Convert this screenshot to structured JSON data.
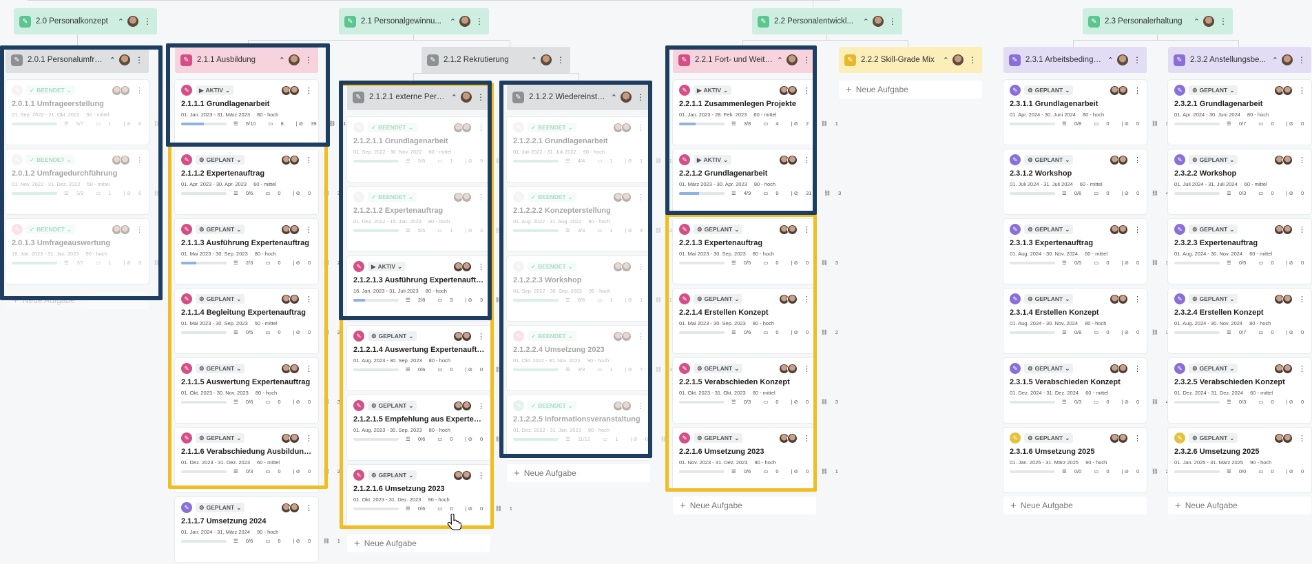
{
  "colors": {
    "green_header": "#cdeee1",
    "gray_header": "#dedfe0",
    "pink_header": "#f7d3dd",
    "yellow_header": "#fbeeb8",
    "purple_header": "#e2ddf5",
    "highlight_blue": "#1d3d61",
    "highlight_yellow": "#f0be22"
  },
  "icons": {
    "header_edit": "pencil-icon",
    "collapse": "chevron-up-icon",
    "avatar": "avatar-icon",
    "more": "kebab-menu-icon",
    "add": "plus-icon",
    "cursor": "hand-pointer-icon"
  },
  "add_label": "Neue Aufgabe",
  "top_headers": [
    {
      "title": "2.0 Personalkonzept",
      "color": "green"
    },
    {
      "title": "2.1 Personalgewinnu...",
      "color": "green"
    },
    {
      "title": "2.2 Personalentwickl...",
      "color": "green"
    },
    {
      "title": "2.3 Personalerhaltung",
      "color": "green"
    }
  ],
  "mid_headers": [
    {
      "title": "2.1.2 Rekrutierung",
      "color": "gray"
    }
  ],
  "columns": [
    {
      "title": "2.0.1 Personalumfrage",
      "color": "gray",
      "show_add": true,
      "add_faded": true,
      "cards": [
        {
          "status": "BEENDET",
          "title": "2.0.1.1 Umfrageerstellung",
          "dates": "01. Sep. 2022 - 21. Okt. 2022",
          "priority": "50 - mittel",
          "progress": 1.0,
          "subtasks": "5/7",
          "comments": "1",
          "attachments": "6",
          "links": "1",
          "pen": "#e6e6e6",
          "faded": true
        },
        {
          "status": "BEENDET",
          "title": "2.0.1.2 Umfragedurchführung",
          "dates": "01. Nov. 2022 - 31. Dez. 2022",
          "priority": "50 - mittel",
          "progress": 1.0,
          "subtasks": "3/3",
          "comments": "1",
          "attachments": "6",
          "links": "2",
          "pen": "#e6e6e6",
          "faded": true
        },
        {
          "status": "BEENDET",
          "title": "2.0.1.3 Umfrageauswertung",
          "dates": "16. Jan. 2023 - 31. Jan. 2023",
          "priority": "90 - hoch",
          "progress": 1.0,
          "subtasks": "7/7",
          "comments": "1",
          "attachments": "3",
          "links": "2",
          "pen": "#f5b8c8",
          "faded": true
        }
      ]
    },
    {
      "title": "2.1.1 Ausbildung",
      "color": "pink",
      "show_add": false,
      "cards": [
        {
          "status": "AKTIV",
          "title": "2.1.1.1 Grundlagenarbeit",
          "dates": "01. Jan. 2023 - 31. März 2023",
          "priority": "80 - hoch",
          "progress": 0.5,
          "subtasks": "5/10",
          "comments": "8",
          "attachments": "39",
          "links": "1",
          "pen": "#d44f87"
        },
        {
          "status": "GEPLANT",
          "title": "2.1.1.2 Expertenauftrag",
          "dates": "01. Apr. 2023 - 30. Apr. 2023",
          "priority": "60 - mittel",
          "progress": 0,
          "subtasks": "0/6",
          "comments": "0",
          "attachments": "0",
          "links": "3",
          "pen": "#d44f87"
        },
        {
          "status": "GEPLANT",
          "title": "2.1.1.3 Ausführung Expertenauftrag",
          "dates": "01. Mai 2023 - 30. Sep. 2023",
          "priority": "80 - hoch",
          "progress": 0.33,
          "subtasks": "2/3",
          "comments": "0",
          "attachments": "0",
          "links": "2",
          "pen": "#d44f87"
        },
        {
          "status": "GEPLANT",
          "title": "2.1.1.4 Begleitung Expertenauftrag",
          "dates": "01. Mai 2023 - 30. Sep. 2023",
          "priority": "50 - mittel",
          "progress": 0,
          "subtasks": "0/5",
          "comments": "0",
          "attachments": "0",
          "links": "2",
          "pen": "#d44f87"
        },
        {
          "status": "GEPLANT",
          "title": "2.1.1.5 Auswertung Expertenauftrag",
          "dates": "01. Okt. 2023 - 30. Nov. 2023",
          "priority": "80 - hoch",
          "progress": 0,
          "subtasks": "0/6",
          "comments": "0",
          "attachments": "0",
          "links": "3",
          "pen": "#d44f87"
        },
        {
          "status": "GEPLANT",
          "title": "2.1.1.6 Verabschiedung Ausbildungsk...",
          "dates": "01. Dez. 2023 - 31. Dez. 2023",
          "priority": "60 - mittel",
          "progress": 0,
          "subtasks": "0/3",
          "comments": "0",
          "attachments": "0",
          "links": "2",
          "pen": "#d44f87"
        },
        {
          "status": "GEPLANT",
          "title": "2.1.1.7 Umsetzung 2024",
          "dates": "01. Jan. 2024 - 31. März 2024",
          "priority": "90 - hoch",
          "progress": 0,
          "subtasks": "0/6",
          "comments": "0",
          "attachments": "0",
          "links": "1",
          "pen": "#8a6fd8"
        }
      ]
    },
    {
      "title": "2.1.2.1 externe Perso...",
      "color": "gray",
      "show_add": true,
      "cards": [
        {
          "status": "BEENDET",
          "title": "2.1.2.1.1 Grundlagenarbeit",
          "dates": "01. Sep. 2022 - 30. Nov. 2022",
          "priority": "60 - mittel",
          "progress": 1.0,
          "subtasks": "5/5",
          "comments": "1",
          "attachments": "9",
          "links": "1",
          "pen": "#e6e6e6",
          "faded": true
        },
        {
          "status": "BEENDET",
          "title": "2.1.2.1.2 Expertenauftrag",
          "dates": "01. Dez. 2022 - 15. Jan. 2023",
          "priority": "80 - hoch",
          "progress": 1.0,
          "subtasks": "5/5",
          "comments": "1",
          "attachments": "3",
          "links": "2",
          "pen": "#e6e6e6",
          "faded": true
        },
        {
          "status": "AKTIV",
          "title": "2.1.2.1.3 Ausführung Expertenauftrag",
          "dates": "16. Jan. 2023 - 31. Juli 2023",
          "priority": "80 - hoch",
          "progress": 0.25,
          "subtasks": "2/8",
          "comments": "3",
          "attachments": "3",
          "links": "2",
          "pen": "#d44f87"
        },
        {
          "status": "GEPLANT",
          "title": "2.1.2.1.4 Auswertung Expertenauftrag",
          "dates": "01. Aug. 2023 - 30. Sep. 2023",
          "priority": "80 - hoch",
          "progress": 0,
          "subtasks": "0/6",
          "comments": "0",
          "attachments": "0",
          "links": "3",
          "pen": "#d44f87"
        },
        {
          "status": "GEPLANT",
          "title": "2.1.2.1.5 Empfehlung aus Expertenber...",
          "dates": "01. Aug. 2023 - 30. Sep. 2023",
          "priority": "80 - hoch",
          "progress": 0,
          "subtasks": "0/6",
          "comments": "0",
          "attachments": "0",
          "links": "2",
          "pen": "#d44f87"
        },
        {
          "status": "GEPLANT",
          "title": "2.1.2.1.6 Umsetzung 2023",
          "dates": "01. Okt. 2023 - 31. Dez. 2023",
          "priority": "90 - hoch",
          "progress": 0,
          "subtasks": "0/6",
          "comments": "0",
          "attachments": "0",
          "links": "1",
          "pen": "#d44f87"
        }
      ]
    },
    {
      "title": "2.1.2.2 Wiedereinstei...",
      "color": "gray",
      "show_add": true,
      "cards": [
        {
          "status": "BEENDET",
          "title": "2.1.2.2.1 Grundlagenarbeit",
          "dates": "01. Juli 2022 - 31. Juli 2022",
          "priority": "90 - hoch",
          "progress": 1.0,
          "subtasks": "4/4",
          "comments": "1",
          "attachments": "1",
          "links": "1",
          "pen": "#e6e6e6",
          "faded": true
        },
        {
          "status": "BEENDET",
          "title": "2.1.2.2.2 Konzepterstellung",
          "dates": "01. Aug. 2022 - 31. Aug. 2022",
          "priority": "90 - hoch",
          "progress": 1.0,
          "subtasks": "3/3",
          "comments": "1",
          "attachments": "4",
          "links": "2",
          "pen": "#e6e6e6",
          "faded": true
        },
        {
          "status": "BEENDET",
          "title": "2.1.2.2.3 Workshop",
          "dates": "01. Sep. 2022 - 30. Sep. 2022",
          "priority": "90 - hoch",
          "progress": 1.0,
          "subtasks": "6/6",
          "comments": "1",
          "attachments": "1",
          "links": "1",
          "pen": "#e6e6e6",
          "faded": true
        },
        {
          "status": "BEENDET",
          "title": "2.1.2.2.4 Umsetzung 2023",
          "dates": "01. Okt. 2022 - 30. Nov. 2022",
          "priority": "90 - hoch",
          "progress": 1.0,
          "subtasks": "3/3",
          "comments": "1",
          "attachments": "7",
          "links": "3",
          "pen": "#f5b8c8",
          "faded": true
        },
        {
          "status": "BEENDET",
          "title": "2.1.2.2.5 Informationsveranstaltung",
          "dates": "01. Dez. 2022 - 31. Jan. 2023",
          "priority": "90 - hoch",
          "progress": 1.0,
          "subtasks": "11/12",
          "comments": "1",
          "attachments": "0",
          "links": "1",
          "pen": "#b8e6cc",
          "faded": true
        }
      ]
    },
    {
      "title": "2.2.1 Fort- und Weite...",
      "color": "pink",
      "show_add": true,
      "cards": [
        {
          "status": "AKTIV",
          "title": "2.2.1.1 Zusammenlegen Projekte",
          "dates": "01. Jan. 2023 - 28. Feb. 2023",
          "priority": "60 - mittel",
          "progress": 0.37,
          "subtasks": "3/8",
          "comments": "4",
          "attachments": "2",
          "links": "1",
          "pen": "#d44f87"
        },
        {
          "status": "AKTIV",
          "title": "2.2.1.2 Grundlagenarbeit",
          "dates": "01. März 2023 - 30. Apr. 2023",
          "priority": "80 - hoch",
          "progress": 0.44,
          "subtasks": "4/9",
          "comments": "9",
          "attachments": "31",
          "links": "3",
          "pen": "#d44f87"
        },
        {
          "status": "GEPLANT",
          "title": "2.2.1.3 Expertenauftrag",
          "dates": "01. Mai 2023 - 30. Sep. 2023",
          "priority": "80 - hoch",
          "progress": 0,
          "subtasks": "0/5",
          "comments": "0",
          "attachments": "0",
          "links": "3",
          "pen": "#d44f87"
        },
        {
          "status": "GEPLANT",
          "title": "2.2.1.4 Erstellen Konzept",
          "dates": "01. Mai 2023 - 30. Sep. 2023",
          "priority": "80 - hoch",
          "progress": 0,
          "subtasks": "0/6",
          "comments": "0",
          "attachments": "0",
          "links": "2",
          "pen": "#d44f87"
        },
        {
          "status": "GEPLANT",
          "title": "2.2.1.5 Verabschieden Konzept",
          "dates": "01. Okt. 2023 - 31. Okt. 2023",
          "priority": "60 - mittel",
          "progress": 0,
          "subtasks": "0/3",
          "comments": "0",
          "attachments": "0",
          "links": "3",
          "pen": "#d44f87"
        },
        {
          "status": "GEPLANT",
          "title": "2.2.1.6 Umsetzung 2023",
          "dates": "01. Nov. 2023 - 31. Dez. 2023",
          "priority": "90 - hoch",
          "progress": 0,
          "subtasks": "0/6",
          "comments": "0",
          "attachments": "0",
          "links": "1",
          "pen": "#d44f87"
        }
      ]
    },
    {
      "title": "2.2.2 Skill-Grade Mix",
      "color": "yellow",
      "show_add": true,
      "cards": []
    },
    {
      "title": "2.3.1 Arbeitsbedingu...",
      "color": "purple",
      "show_add": true,
      "cards": [
        {
          "status": "GEPLANT",
          "title": "2.3.1.1 Grundlagenarbeit",
          "dates": "01. Apr. 2024 - 30. Juni 2024",
          "priority": "80 - hoch",
          "progress": 0,
          "subtasks": "0/8",
          "comments": "0",
          "attachments": "0",
          "links": "3",
          "pen": "#8a6fd8"
        },
        {
          "status": "GEPLANT",
          "title": "2.3.1.2 Workshop",
          "dates": "01. Juli 2024 - 31. Juli 2024",
          "priority": "60 - mittel",
          "progress": 0,
          "subtasks": "0/6",
          "comments": "0",
          "attachments": "0",
          "links": "4",
          "pen": "#8a6fd8"
        },
        {
          "status": "GEPLANT",
          "title": "2.3.1.3 Expertenauftrag",
          "dates": "01. Aug. 2024 - 30. Nov. 2024",
          "priority": "60 - mittel",
          "progress": 0,
          "subtasks": "0/5",
          "comments": "0",
          "attachments": "0",
          "links": "3",
          "pen": "#8a6fd8"
        },
        {
          "status": "GEPLANT",
          "title": "2.3.1.4 Erstellen Konzept",
          "dates": "01. Aug. 2024 - 30. Nov. 2024",
          "priority": "80 - hoch",
          "progress": 0,
          "subtasks": "0/8",
          "comments": "0",
          "attachments": "0",
          "links": "3",
          "pen": "#8a6fd8"
        },
        {
          "status": "GEPLANT",
          "title": "2.3.1.5 Verabschieden Konzept",
          "dates": "01. Dez. 2024 - 31. Dez. 2024",
          "priority": "60 - mittel",
          "progress": 0,
          "subtasks": "0/3",
          "comments": "0",
          "attachments": "0",
          "links": "4",
          "pen": "#8a6fd8"
        },
        {
          "status": "GEPLANT",
          "title": "2.3.1.6 Umsetzung 2025",
          "dates": "01. Jan. 2025 - 31. März 2025",
          "priority": "90 - hoch",
          "progress": 0,
          "subtasks": "0/0",
          "comments": "0",
          "attachments": "0",
          "links": "2",
          "pen": "#e6c23a"
        }
      ]
    },
    {
      "title": "2.3.2 Anstellungsbe...",
      "color": "purple",
      "show_add": true,
      "cards": [
        {
          "status": "GEPLANT",
          "title": "2.3.2.1 Grundlagenarbeit",
          "dates": "01. Apr. 2024 - 30. Juni 2024",
          "priority": "80 - hoch",
          "progress": 0,
          "subtasks": "0/7",
          "comments": "0",
          "attachments": "0",
          "links": "3",
          "pen": "#8a6fd8"
        },
        {
          "status": "GEPLANT",
          "title": "2.3.2.2 Workshop",
          "dates": "01. Juli 2024 - 31. Juli 2024",
          "priority": "60 - mittel",
          "progress": 0,
          "subtasks": "0/3",
          "comments": "0",
          "attachments": "0",
          "links": "4",
          "pen": "#8a6fd8"
        },
        {
          "status": "GEPLANT",
          "title": "2.3.2.3 Expertenauftrag",
          "dates": "01. Aug. 2024 - 30. Nov. 2024",
          "priority": "60 - mittel",
          "progress": 0,
          "subtasks": "0/5",
          "comments": "0",
          "attachments": "0",
          "links": "3",
          "pen": "#8a6fd8"
        },
        {
          "status": "GEPLANT",
          "title": "2.3.2.4 Erstellen Konzept",
          "dates": "01. Aug. 2024 - 30. Nov. 2024",
          "priority": "80 - hoch",
          "progress": 0,
          "subtasks": "0/7",
          "comments": "0",
          "attachments": "0",
          "links": "3",
          "pen": "#8a6fd8"
        },
        {
          "status": "GEPLANT",
          "title": "2.3.2.5 Verabschieden Konzept",
          "dates": "01. Dez. 2024 - 31. Dez. 2024",
          "priority": "60 - mittel",
          "progress": 0,
          "subtasks": "0/3",
          "comments": "0",
          "attachments": "0",
          "links": "4",
          "pen": "#8a6fd8"
        },
        {
          "status": "GEPLANT",
          "title": "2.3.2.6 Umsetzung 2025",
          "dates": "01. Jan. 2025 - 31. März 2025",
          "priority": "90 - hoch",
          "progress": 0,
          "subtasks": "0/0",
          "comments": "0",
          "attachments": "0",
          "links": "2",
          "pen": "#e6c23a"
        }
      ]
    }
  ]
}
